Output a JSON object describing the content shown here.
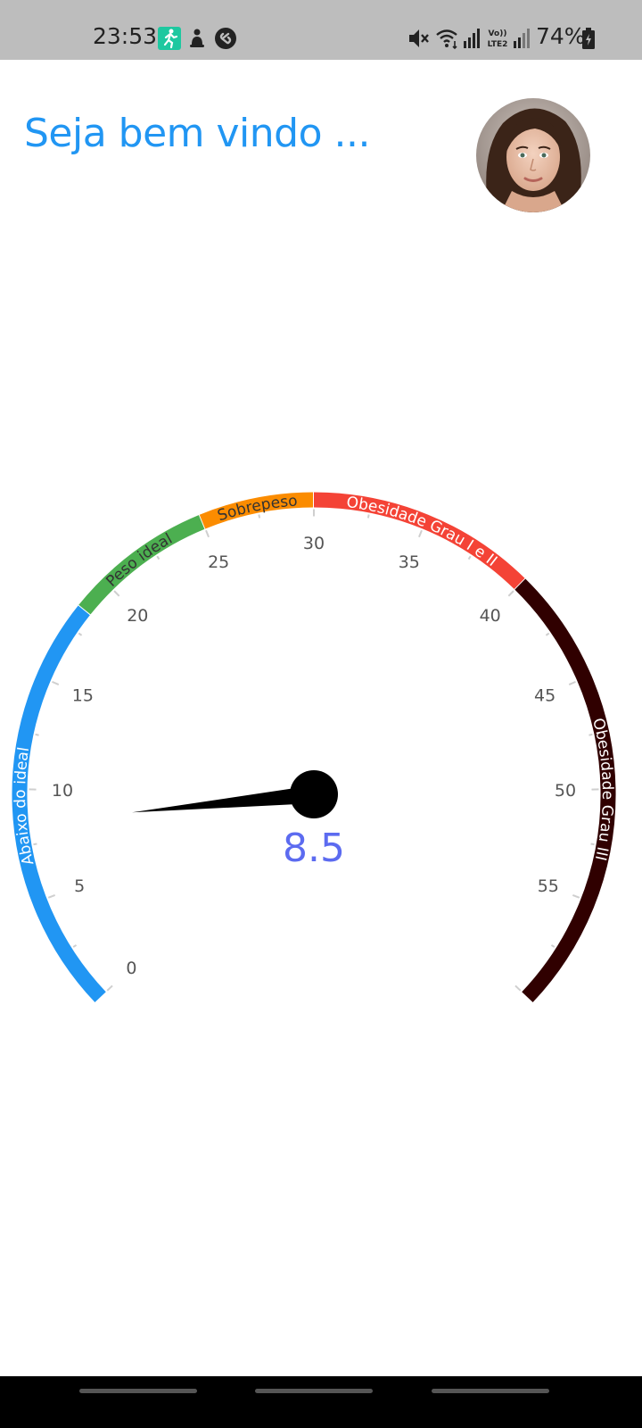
{
  "status_bar": {
    "time": "23:53",
    "battery": "74%",
    "icons": [
      "running-app-icon",
      "notification-icon",
      "shazam-icon",
      "mute-icon",
      "wifi-icon",
      "signal-icon",
      "volte-lte2-icon",
      "signal-icon-2",
      "battery-icon"
    ],
    "volte_text": "Vo)) LTE2"
  },
  "header": {
    "welcome_text": "Seja bem vindo ...",
    "avatar_icon": "user-avatar"
  },
  "gauge": {
    "value_text": "8.5",
    "value": 8.5,
    "min": 0,
    "max": 60,
    "ticks": [
      "0",
      "5",
      "10",
      "15",
      "20",
      "25",
      "30",
      "35",
      "40",
      "45",
      "50",
      "55"
    ],
    "ranges": [
      {
        "label": "Abaixo do ideal",
        "from": 0,
        "to": 18.5,
        "color": "#2196f3",
        "label_color": "#ffffff"
      },
      {
        "label": "Peso ideal",
        "from": 18.5,
        "to": 25,
        "color": "#4caf50",
        "label_color": "#333333"
      },
      {
        "label": "Sobrepeso",
        "from": 25,
        "to": 30,
        "color": "#fb8c00",
        "label_color": "#333333"
      },
      {
        "label": "Obesidade Grau I e II",
        "from": 30,
        "to": 40,
        "color": "#f44336",
        "label_color": "#ffffff"
      },
      {
        "label": "Obesidade Grau III",
        "from": 40,
        "to": 60,
        "color": "#300000",
        "label_color": "#ffffff"
      }
    ],
    "value_color": "#5c6bf0",
    "needle_color": "#000000"
  }
}
